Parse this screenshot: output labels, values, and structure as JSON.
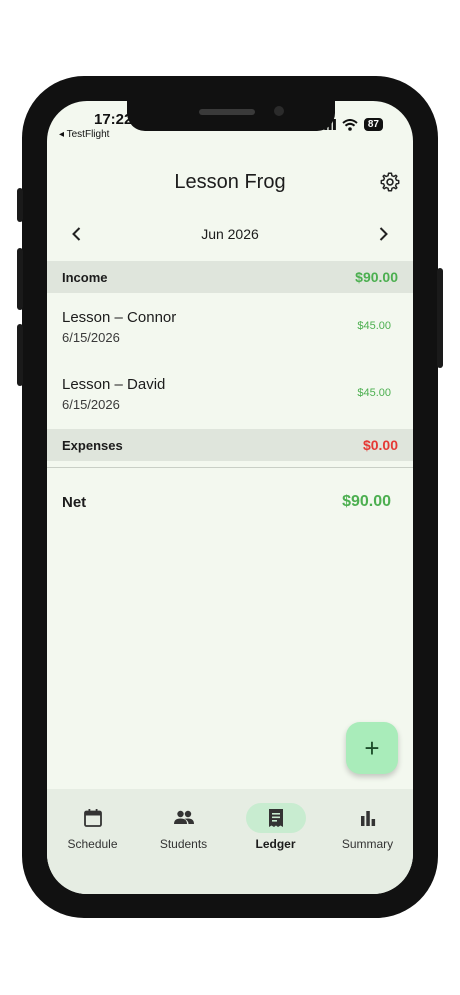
{
  "status_bar": {
    "time": "17:22",
    "back_label": "◂ TestFlight",
    "battery": "87"
  },
  "header": {
    "title": "Lesson Frog"
  },
  "month_nav": {
    "label": "Jun 2026"
  },
  "income": {
    "label": "Income",
    "total": "$90.00",
    "items": [
      {
        "name": "Lesson – Connor",
        "date": "6/15/2026",
        "amount": "$45.00"
      },
      {
        "name": "Lesson – David",
        "date": "6/15/2026",
        "amount": "$45.00"
      }
    ]
  },
  "expenses": {
    "label": "Expenses",
    "total": "$0.00"
  },
  "net": {
    "label": "Net",
    "total": "$90.00"
  },
  "fab": {
    "symbol": "+"
  },
  "tabs": [
    {
      "label": "Schedule",
      "icon": "calendar-icon",
      "active": false
    },
    {
      "label": "Students",
      "icon": "people-icon",
      "active": false
    },
    {
      "label": "Ledger",
      "icon": "receipt-icon",
      "active": true
    },
    {
      "label": "Summary",
      "icon": "bar-chart-icon",
      "active": false
    }
  ],
  "colors": {
    "income_green": "#4caf50",
    "expense_red": "#e53935",
    "accent": "#a9ecba"
  }
}
